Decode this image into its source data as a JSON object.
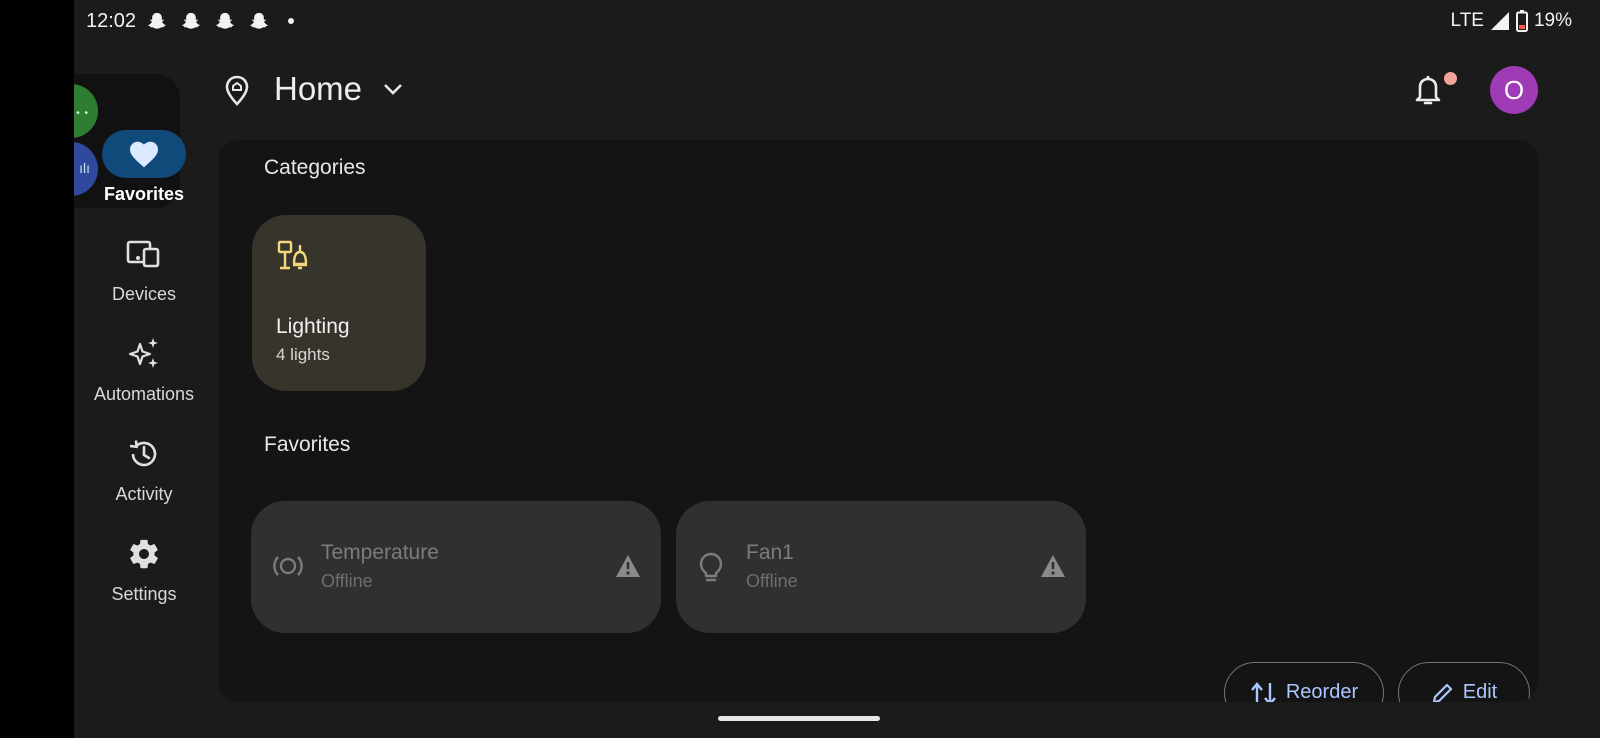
{
  "status_bar": {
    "time": "12:02",
    "network": "LTE",
    "battery": "19%",
    "notification_icons": [
      "snapchat-icon",
      "snapchat-icon",
      "snapchat-icon",
      "snapchat-icon"
    ]
  },
  "header": {
    "title": "Home"
  },
  "avatar": {
    "initial": "O",
    "color": "#9f3bb5"
  },
  "nav": {
    "items": [
      {
        "label": "Favorites",
        "icon": "heart-icon",
        "active": true
      },
      {
        "label": "Devices",
        "icon": "devices-icon",
        "active": false
      },
      {
        "label": "Automations",
        "icon": "sparkle-icon",
        "active": false
      },
      {
        "label": "Activity",
        "icon": "history-icon",
        "active": false
      },
      {
        "label": "Settings",
        "icon": "gear-icon",
        "active": false
      }
    ]
  },
  "categories": {
    "title": "Categories",
    "items": [
      {
        "name": "Lighting",
        "sub": "4 lights",
        "icon": "lamp-icon"
      }
    ]
  },
  "favorites": {
    "title": "Favorites",
    "items": [
      {
        "name": "Temperature",
        "status": "Offline",
        "icon": "sensor-icon"
      },
      {
        "name": "Fan1",
        "status": "Offline",
        "icon": "lightbulb-icon"
      }
    ]
  },
  "actions": {
    "reorder": "Reorder",
    "edit": "Edit"
  },
  "colors": {
    "accent": "#a9c7ff",
    "active_nav": "#0f4a7a",
    "category_card": "#37342c",
    "lamp_icon": "#f3d77a"
  }
}
